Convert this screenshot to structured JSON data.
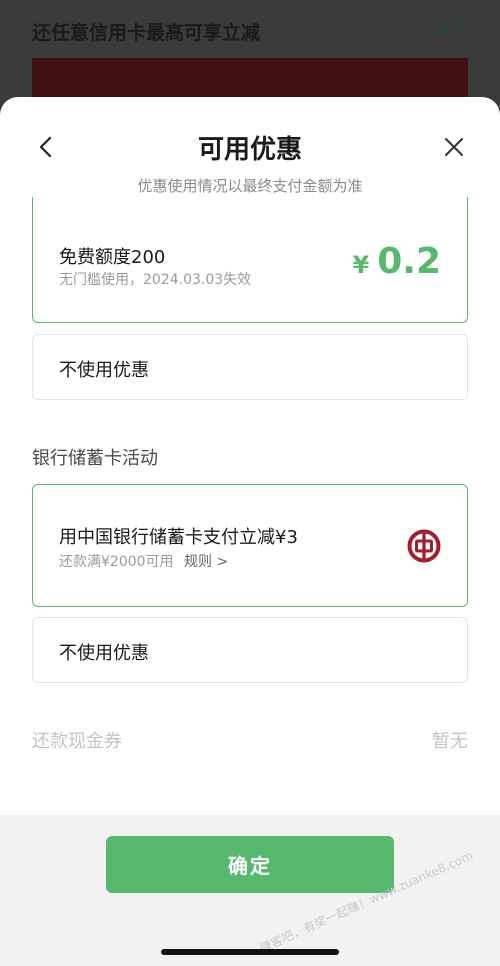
{
  "background": {
    "promo_text": "还任意信用卡最高可享立减",
    "promo_amount": "¥ 3"
  },
  "sheet": {
    "title": "可用优惠",
    "subtitle": "优惠使用情况以最终支付金额为准",
    "icons": {
      "back": "chevron-left-icon",
      "close": "close-icon"
    }
  },
  "free_quota_card": {
    "title": "免费额度200",
    "subtitle": "无门槛使用，2024.03.03失效",
    "currency": "¥",
    "amount": "0.2",
    "selected": true
  },
  "no_discount_1": {
    "label": "不使用优惠"
  },
  "debit_section": {
    "label": "银行储蓄卡活动",
    "card": {
      "title": "用中国银行储蓄卡支付立减¥3",
      "subtitle": "还款满¥2000可用",
      "rules_link": "规则 >",
      "icon": "bank-of-china-logo-icon",
      "selected": true
    }
  },
  "no_discount_2": {
    "label": "不使用优惠"
  },
  "cash_coupon": {
    "label": "还款现金券",
    "value": "暂无"
  },
  "confirm_button": "确定",
  "watermark": "赚客吧，有奖一起赚！www.zuanke8.com",
  "colors": {
    "accent": "#56b96e",
    "boc_red": "#a51d2d"
  }
}
